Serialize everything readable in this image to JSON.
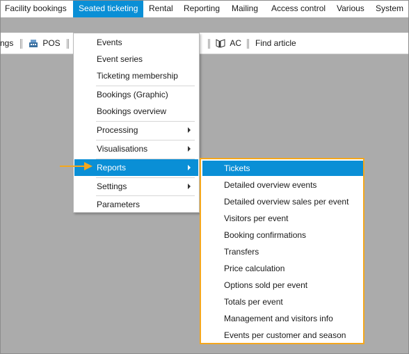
{
  "menubar": {
    "items": [
      {
        "label": "Facility bookings"
      },
      {
        "label": "Seated ticketing"
      },
      {
        "label": "Rental"
      },
      {
        "label": "Reporting"
      },
      {
        "label": "Mailing"
      },
      {
        "label": "Access control"
      },
      {
        "label": "Various"
      },
      {
        "label": "System"
      }
    ],
    "active_index": 1
  },
  "toolbar": {
    "partial_label": "ngs",
    "pos_label": "POS",
    "ac_label": "AC",
    "find_article_label": "Find article",
    "pos_icon": "cash-register-icon",
    "ac_icon": "access-control-icon"
  },
  "dropdown": {
    "items": [
      {
        "label": "Events"
      },
      {
        "label": "Event series"
      },
      {
        "label": "Ticketing membership"
      },
      {
        "label": "Bookings (Graphic)"
      },
      {
        "label": "Bookings overview"
      },
      {
        "label": "Processing"
      },
      {
        "label": "Visualisations"
      },
      {
        "label": "Reports"
      },
      {
        "label": "Settings"
      },
      {
        "label": "Parameters"
      }
    ],
    "selected": "Reports"
  },
  "submenu": {
    "items": [
      {
        "label": "Tickets"
      },
      {
        "label": "Detailed overview events"
      },
      {
        "label": "Detailed overview sales per event"
      },
      {
        "label": "Visitors per event"
      },
      {
        "label": "Booking confirmations"
      },
      {
        "label": "Transfers"
      },
      {
        "label": "Price calculation"
      },
      {
        "label": "Options sold per event"
      },
      {
        "label": "Totals per event"
      },
      {
        "label": "Management and visitors info"
      },
      {
        "label": "Events per customer and season"
      }
    ],
    "selected": "Tickets"
  },
  "colors": {
    "accent": "#0a8fd6",
    "highlight_border": "#f4a71d",
    "workspace": "#ababab"
  }
}
